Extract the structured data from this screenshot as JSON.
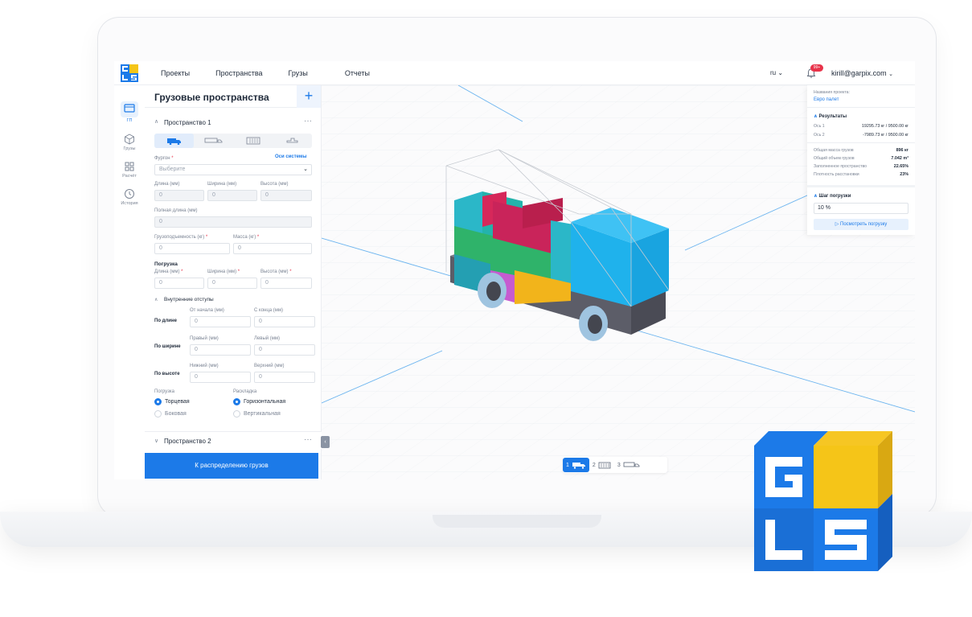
{
  "topbar": {
    "nav": [
      "Проекты",
      "Пространства",
      "Грузы",
      "Отчеты"
    ],
    "lang": "ru",
    "notif_badge": "99+",
    "user": "kirill@garpix.com"
  },
  "rail": {
    "items": [
      {
        "label": "ГП",
        "icon": "truck-space-icon",
        "active": true
      },
      {
        "label": "Грузы",
        "icon": "cube-icon",
        "active": false
      },
      {
        "label": "Расчёт",
        "icon": "grid-icon",
        "active": false
      },
      {
        "label": "История",
        "icon": "clock-icon",
        "active": false
      }
    ]
  },
  "panel": {
    "title": "Грузовые пространства",
    "plus": "+",
    "space1": "Пространство 1",
    "space2": "Пространство 2",
    "van_label": "Фургон",
    "axes_link": "Оси системы",
    "van_placeholder": "Выберите",
    "length_label": "Длина (мм)",
    "width_label": "Ширина (мм)",
    "height_label": "Высота (мм)",
    "full_length_label": "Полная длина (мм)",
    "capacity_label": "Грузоподъемность (кг)",
    "mass_label": "Масса (кг)",
    "loading_title": "Погрузка",
    "loading_length_label": "Длина (мм)",
    "loading_width_label": "Ширина (мм)",
    "loading_height_label": "Высота (мм)",
    "indents_title": "Внутренние отступы",
    "by_length": "По длине",
    "by_width": "По ширине",
    "by_height": "По высоте",
    "from_start": "От начала (мм)",
    "from_end": "С конца (мм)",
    "right": "Правый (мм)",
    "left": "Левый (мм)",
    "bottom": "Нижний (мм)",
    "top": "Верхний (мм)",
    "zero": "0",
    "loading_type_label": "Погрузка",
    "layout_label": "Раскладка",
    "end_loading": "Торцевая",
    "side_loading": "Боковая",
    "horizontal": "Горизонтальная",
    "vertical": "Вертикальная",
    "distribute_btn": "К распределению грузов",
    "dots": "···"
  },
  "results": {
    "project_label": "Названия проекта:",
    "project_name": "Евро палет",
    "title": "Результаты",
    "axis1_label": "Ось 1",
    "axis1_value": "19295.73 кг / 9500.00 кг",
    "axis2_label": "Ось 2",
    "axis2_value": "-7989.73 кг / 9500.00 кг",
    "total_mass_label": "Общая масса грузов",
    "total_mass_value": "896 кг",
    "total_volume_label": "Общий объем грузов",
    "total_volume_value": "7.042 m³",
    "filled_label": "Заполненное пространство",
    "filled_value": "22.65%",
    "density_label": "Плотность расстановки",
    "density_value": "23%",
    "step_title": "Шаг погрузки",
    "step_value": "10 %",
    "view_btn": "Посмотреть погрузку"
  },
  "pager": [
    "1",
    "2",
    "3"
  ],
  "colors": {
    "accent": "#1c7ae8",
    "badge": "#e8334a"
  }
}
